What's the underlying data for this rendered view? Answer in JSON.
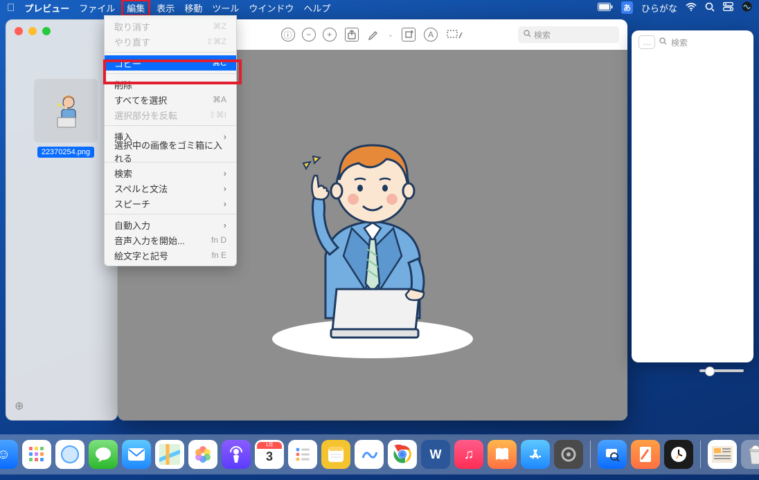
{
  "menubar": {
    "app": "プレビュー",
    "items": [
      "ファイル",
      "編集",
      "表示",
      "移動",
      "ツール",
      "ウインドウ",
      "ヘルプ"
    ],
    "input_mode_badge": "あ",
    "input_mode_label": "ひらがな"
  },
  "sidebar": {
    "thumb_filename": "22370254.png"
  },
  "edit_menu": {
    "undo": {
      "label": "取り消す",
      "shortcut": "⌘Z"
    },
    "redo": {
      "label": "やり直す",
      "shortcut": "⇧⌘Z"
    },
    "copy": {
      "label": "コピー",
      "shortcut": "⌘C"
    },
    "delete": {
      "label": "削除"
    },
    "select_all": {
      "label": "すべてを選択",
      "shortcut": "⌘A"
    },
    "invert_selection": {
      "label": "選択部分を反転",
      "shortcut": "⇧⌘I"
    },
    "insert": {
      "label": "挿入"
    },
    "trash_image": {
      "label": "選択中の画像をゴミ箱に入れる"
    },
    "find": {
      "label": "検索"
    },
    "spelling": {
      "label": "スペルと文法"
    },
    "speech": {
      "label": "スピーチ"
    },
    "autofill": {
      "label": "自動入力"
    },
    "start_dictation": {
      "label": "音声入力を開始...",
      "shortcut": "fn D"
    },
    "emoji": {
      "label": "絵文字と記号",
      "shortcut": "fn E"
    }
  },
  "preview_toolbar": {
    "search_placeholder": "検索"
  },
  "right_panel": {
    "search_placeholder": "検索",
    "back_label": "…"
  }
}
